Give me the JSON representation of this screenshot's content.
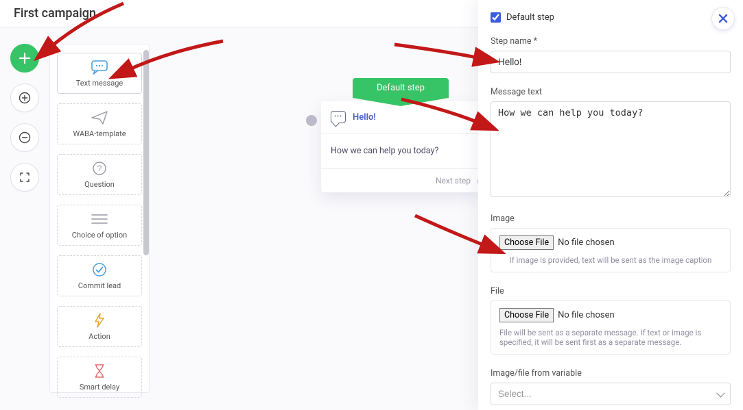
{
  "header": {
    "title": "First campaign"
  },
  "palette": {
    "items": [
      {
        "key": "text",
        "label": "Text message"
      },
      {
        "key": "waba",
        "label": "WABA-template"
      },
      {
        "key": "question",
        "label": "Question"
      },
      {
        "key": "choice",
        "label": "Choice of option"
      },
      {
        "key": "commit",
        "label": "Commit lead"
      },
      {
        "key": "action",
        "label": "Action"
      },
      {
        "key": "delay",
        "label": "Smart delay"
      }
    ]
  },
  "step_card": {
    "default_label": "Default step",
    "title": "Hello!",
    "message": "How we can help you today?",
    "next_label": "Next step"
  },
  "panel": {
    "default_checkbox": {
      "label": "Default step",
      "checked": true
    },
    "step_name": {
      "label": "Step name *",
      "value": "Hello!"
    },
    "message": {
      "label": "Message text",
      "value": "How we can help you today?"
    },
    "image": {
      "label": "Image",
      "button": "Choose File",
      "status": "No file chosen",
      "help": "If image is provided, text will be sent as the image caption"
    },
    "file": {
      "label": "File",
      "button": "Choose File",
      "status": "No file chosen",
      "help": "File will be sent as a separate message. If text or image is specified, it will be sent first as a separate message."
    },
    "var": {
      "label": "Image/file from variable",
      "placeholder": "Select..."
    }
  }
}
